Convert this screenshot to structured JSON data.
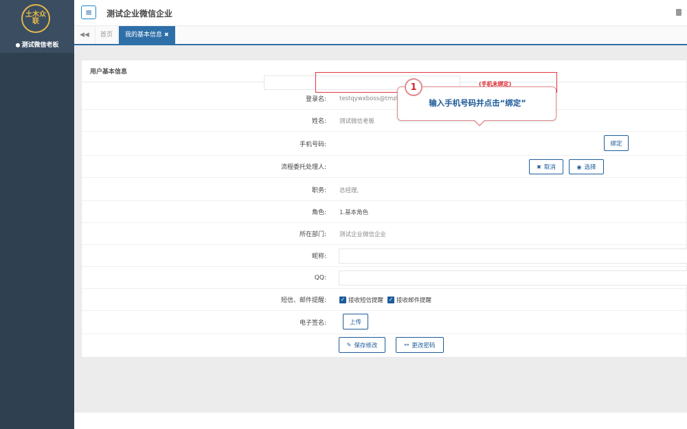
{
  "sidebar": {
    "logo_text": "土木众联",
    "user_name": "测试微信老板"
  },
  "header": {
    "title": "测试企业微信企业"
  },
  "tabs": {
    "home_label": "首页",
    "active_label": "我的基本信息"
  },
  "panel": {
    "title": "用户基本信息",
    "login_label": "登录名:",
    "login_value": "testqywxboss@tmzl...",
    "name_label": "姓名:",
    "name_value": "测试微信老板",
    "phone_label": "手机号码:",
    "phone_value": "",
    "phone_status": "(手机未绑定)",
    "bind_label": "绑定",
    "delegate_label": "流程委托处理人:",
    "cancel_label": "取消",
    "select_label": "选择",
    "position_label": "职务:",
    "position_value": "总经理,",
    "role_label": "角色:",
    "role_value": "1.基本角色",
    "dept_label": "所在部门:",
    "dept_value": "测试企业微信企业",
    "nickname_label": "昵称:",
    "qq_label": "QQ:",
    "reminder_label": "短信、邮件提醒:",
    "sms_label": "接收短信提醒",
    "email_label": "接收邮件提醒",
    "signature_label": "电子签名:",
    "upload_label": "上传",
    "save_label": "保存修改",
    "change_pwd_label": "更改密码"
  },
  "callout": {
    "step": "1",
    "text": "输入手机号码并点击“绑定”"
  }
}
